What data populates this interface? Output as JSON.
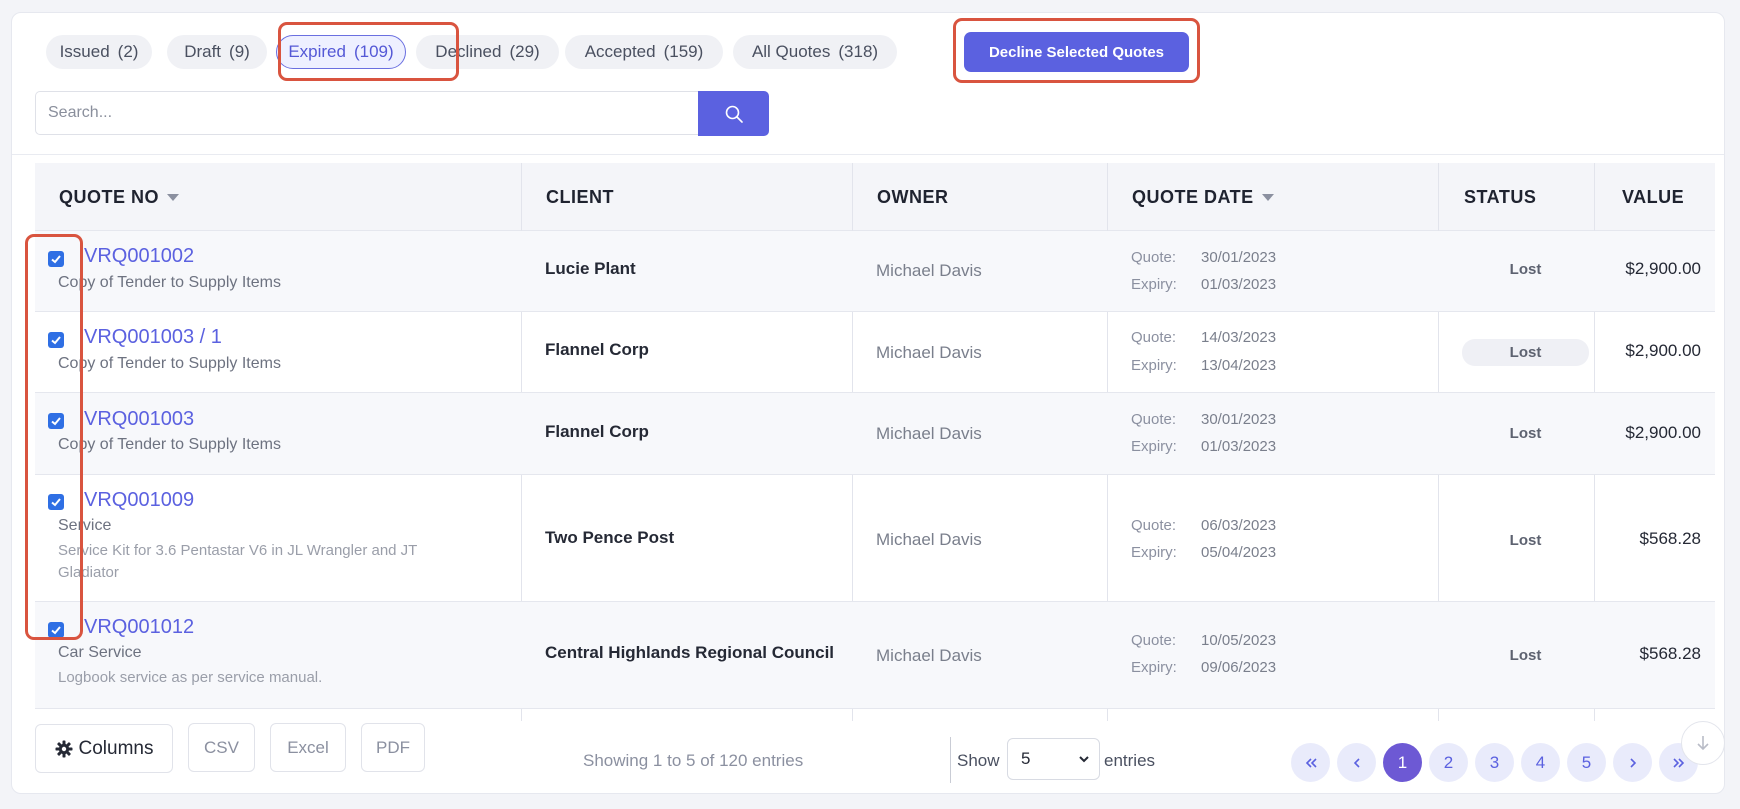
{
  "tabs": [
    {
      "label": "Issued",
      "count": "(2)"
    },
    {
      "label": "Draft",
      "count": "(9)"
    },
    {
      "label": "Expired",
      "count": "(109)"
    },
    {
      "label": "Declined",
      "count": "(29)"
    },
    {
      "label": "Accepted",
      "count": "(159)"
    },
    {
      "label": "All Quotes",
      "count": "(318)"
    }
  ],
  "decline_button": "Decline Selected Quotes",
  "search": {
    "placeholder": "Search...",
    "value": ""
  },
  "columns": {
    "quote_no": "QUOTE NO",
    "client": "CLIENT",
    "owner": "OWNER",
    "quote_date": "QUOTE DATE",
    "status": "STATUS",
    "value": "VALUE"
  },
  "rows": [
    {
      "quote_no": "VRQ001002",
      "subtitle": "Copy of Tender to Supply Items",
      "description": "",
      "client": "Lucie Plant",
      "owner": "Michael Davis",
      "quote_label": "Quote:",
      "quote_date": "30/01/2023",
      "expiry_label": "Expiry:",
      "expiry_date": "01/03/2023",
      "status": "Lost",
      "value": "$2,900.00",
      "checked": true
    },
    {
      "quote_no": "VRQ001003 / 1",
      "subtitle": "Copy of Tender to Supply Items",
      "description": "",
      "client": "Flannel Corp",
      "owner": "Michael Davis",
      "quote_label": "Quote:",
      "quote_date": "14/03/2023",
      "expiry_label": "Expiry:",
      "expiry_date": "13/04/2023",
      "status": "Lost",
      "value": "$2,900.00",
      "checked": true
    },
    {
      "quote_no": "VRQ001003",
      "subtitle": "Copy of Tender to Supply Items",
      "description": "",
      "client": "Flannel Corp",
      "owner": "Michael Davis",
      "quote_label": "Quote:",
      "quote_date": "30/01/2023",
      "expiry_label": "Expiry:",
      "expiry_date": "01/03/2023",
      "status": "Lost",
      "value": "$2,900.00",
      "checked": true
    },
    {
      "quote_no": "VRQ001009",
      "subtitle": "Service",
      "description": "Service Kit for 3.6 Pentastar V6 in JL Wrangler and JT Gladiator",
      "client": "Two Pence Post",
      "owner": "Michael Davis",
      "quote_label": "Quote:",
      "quote_date": "06/03/2023",
      "expiry_label": "Expiry:",
      "expiry_date": "05/04/2023",
      "status": "Lost",
      "value": "$568.28",
      "checked": true
    },
    {
      "quote_no": "VRQ001012",
      "subtitle": "Car Service",
      "description": "Logbook service as per service manual.",
      "client": "Central Highlands Regional Council",
      "owner": "Michael Davis",
      "quote_label": "Quote:",
      "quote_date": "10/05/2023",
      "expiry_label": "Expiry:",
      "expiry_date": "09/06/2023",
      "status": "Lost",
      "value": "$568.28",
      "checked": true
    }
  ],
  "footer": {
    "columns_button": "Columns",
    "csv": "CSV",
    "excel": "Excel",
    "pdf": "PDF",
    "info": "Showing 1 to 5 of 120 entries",
    "show": "Show",
    "page_size": "5",
    "entries": "entries",
    "pages": [
      "1",
      "2",
      "3",
      "4",
      "5"
    ],
    "current_page": "1"
  },
  "colors": {
    "accent": "#5b61e0",
    "highlight": "#d9543f",
    "active_page": "#6d59d4"
  }
}
